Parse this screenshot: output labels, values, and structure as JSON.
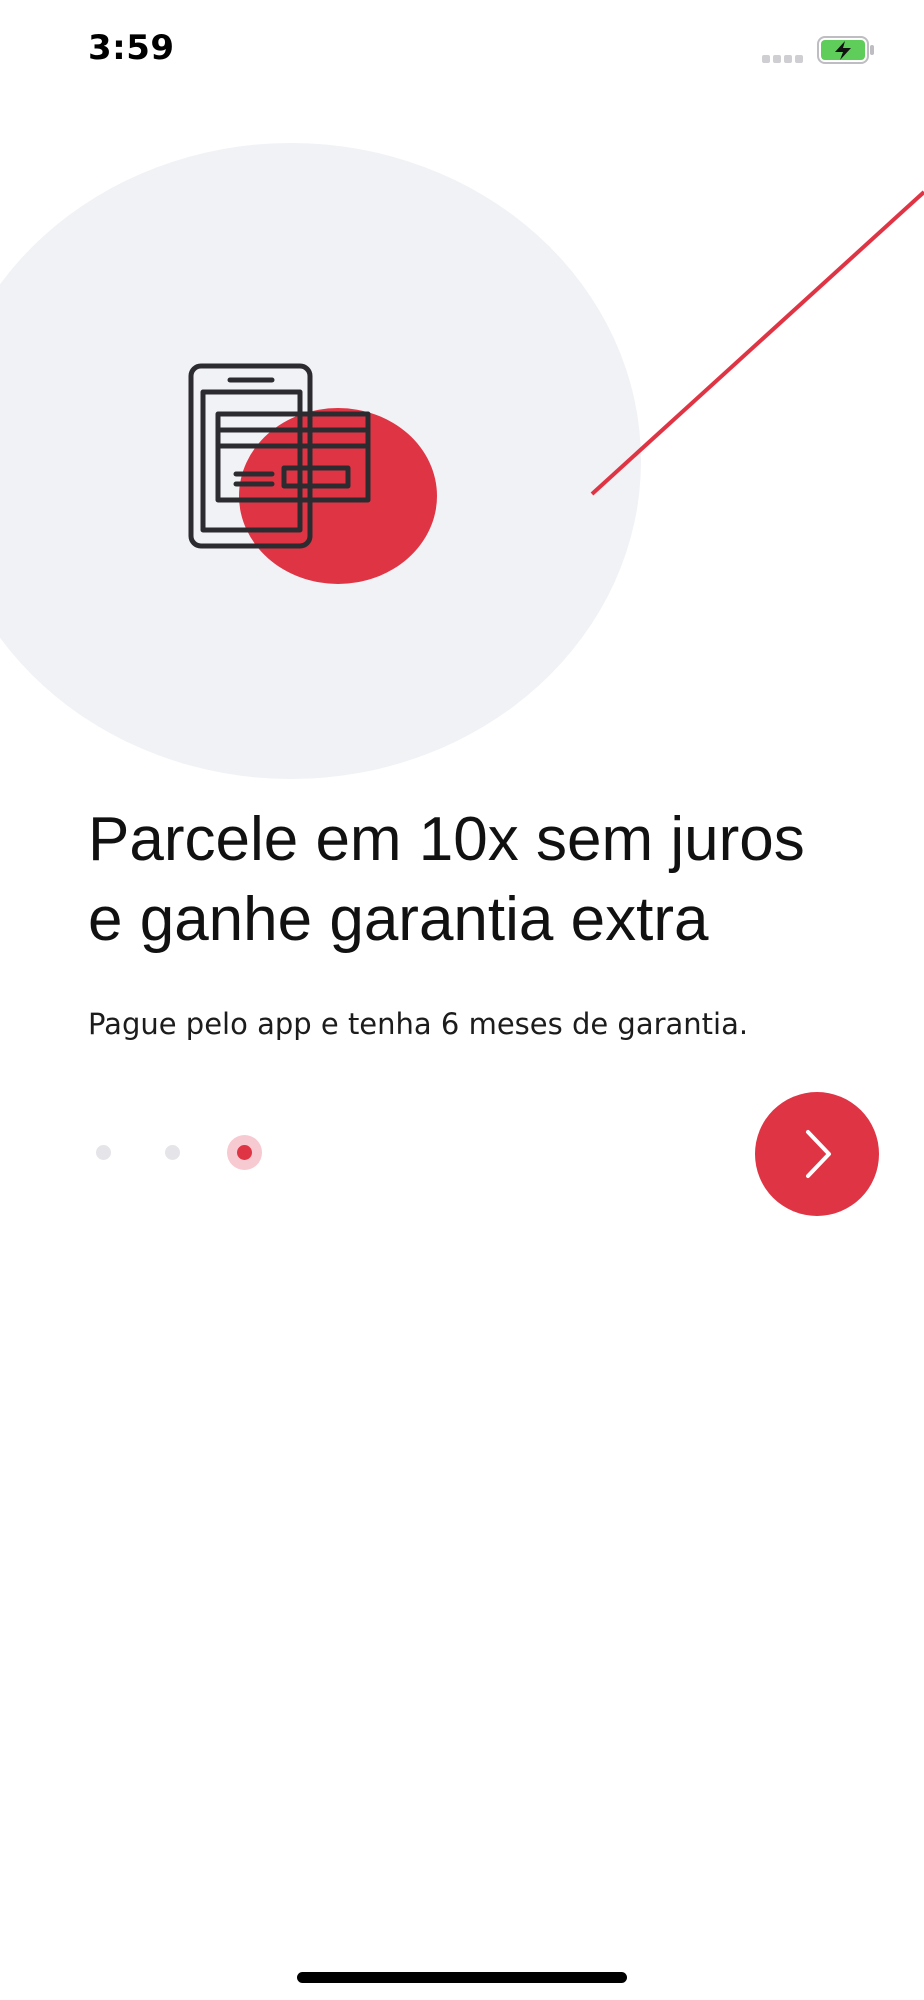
{
  "status_bar": {
    "time": "3:59",
    "battery_icon": "battery-charging-icon",
    "signal_icon": "signal-dots-icon"
  },
  "illustration": {
    "icon": "phone-credit-card-icon",
    "colors": {
      "circle_background": "#f1f2f6",
      "accent": "#df3444",
      "icon_stroke": "#2b2b30"
    }
  },
  "onboarding": {
    "headline": "Parcele em 10x sem juros\ne ganhe garantia extra",
    "subtitle": "Pague pelo app e tenha 6 meses de garantia.",
    "pager": {
      "total": 3,
      "active": 3
    },
    "next_button_icon": "chevron-right-icon"
  },
  "theme": {
    "accent": "#df3444",
    "dot_inactive": "#e5e5e9",
    "dot_active_halo": "#f7c9d0"
  }
}
